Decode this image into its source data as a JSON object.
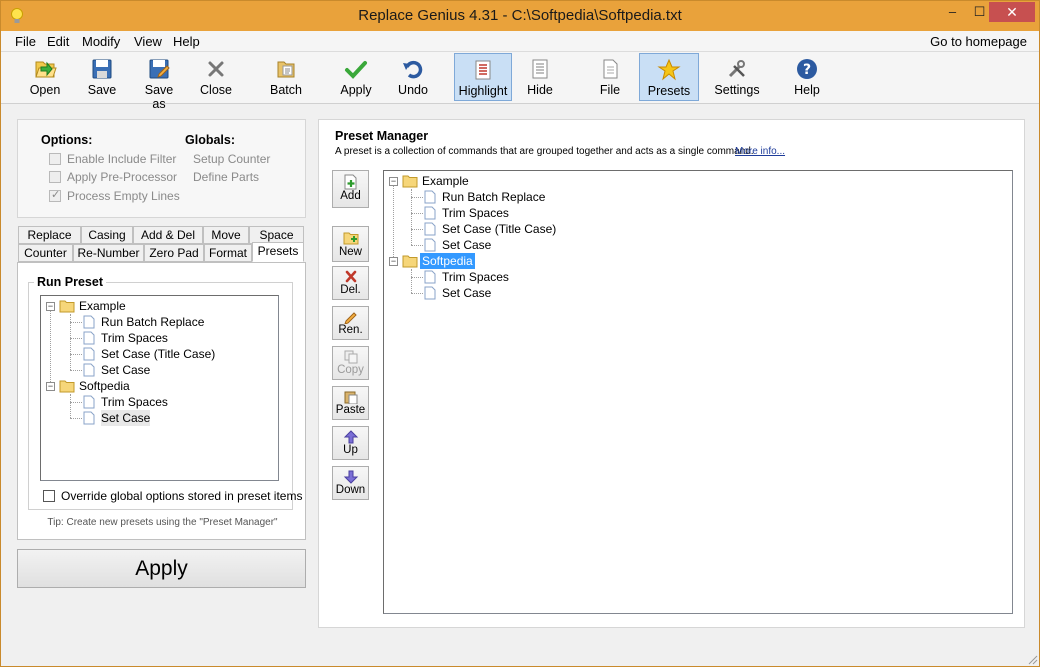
{
  "window": {
    "title": "Replace Genius 4.31 - C:\\Softpedia\\Softpedia.txt",
    "controls": {
      "minimize": "–",
      "maximize": "☐",
      "close": "✕"
    }
  },
  "menu": {
    "items": [
      "File",
      "Edit",
      "Modify",
      "View",
      "Help"
    ],
    "homepage": "Go to homepage"
  },
  "toolbar": {
    "open": "Open",
    "save": "Save",
    "save_as": "Save as",
    "close": "Close",
    "batch": "Batch",
    "apply": "Apply",
    "undo": "Undo",
    "highlight": "Highlight",
    "hide": "Hide",
    "file": "File",
    "presets": "Presets",
    "settings": "Settings",
    "help": "Help"
  },
  "options": {
    "header": "Options:",
    "enable_include_filter": "Enable Include Filter",
    "apply_preprocessor": "Apply Pre-Processor",
    "process_empty_lines": "Process Empty Lines",
    "process_empty_lines_checked": true
  },
  "globals": {
    "header": "Globals:",
    "setup_counter": "Setup Counter",
    "define_parts": "Define Parts"
  },
  "tabs": {
    "row1": [
      "Replace",
      "Casing",
      "Add & Del",
      "Move",
      "Space"
    ],
    "row2": [
      "Counter",
      "Re-Number",
      "Zero Pad",
      "Format",
      "Presets"
    ],
    "selected": "Presets"
  },
  "run_preset": {
    "label": "Run Preset",
    "tree": [
      {
        "name": "Example",
        "children": [
          "Run Batch Replace",
          "Trim Spaces",
          "Set Case (Title Case)",
          "Set Case"
        ]
      },
      {
        "name": "Softpedia",
        "children": [
          "Trim Spaces",
          "Set Case"
        ]
      }
    ],
    "override": "Override global options stored in preset items",
    "tip": "Tip: Create new presets using the \"Preset Manager\""
  },
  "apply_button": "Apply",
  "preset_manager": {
    "title": "Preset Manager",
    "description": "A preset is a collection of commands that are grouped together and acts as a single command.",
    "more_info": "More info...",
    "buttons": {
      "add": "Add",
      "new": "New",
      "delete": "Del.",
      "rename": "Ren.",
      "copy": "Copy",
      "paste": "Paste",
      "up": "Up",
      "down": "Down"
    },
    "tree": [
      {
        "name": "Example",
        "children": [
          "Run Batch Replace",
          "Trim Spaces",
          "Set Case (Title Case)",
          "Set Case"
        ]
      },
      {
        "name": "Softpedia",
        "children": [
          "Trim Spaces",
          "Set Case"
        ]
      }
    ],
    "selected_node": "Softpedia"
  }
}
